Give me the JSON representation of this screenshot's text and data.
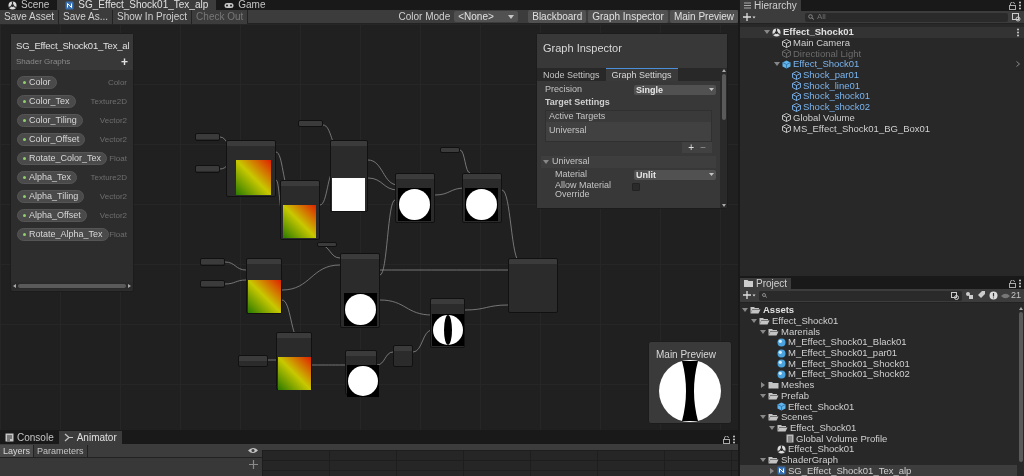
{
  "editor_tabs": [
    {
      "label": "Scene",
      "kind": "scene",
      "selected": false
    },
    {
      "label": "SG_Effect_Shock01_Tex_alp",
      "kind": "shader",
      "selected": true
    },
    {
      "label": "Game",
      "kind": "game",
      "selected": false
    }
  ],
  "toolbar": {
    "left_buttons": [
      {
        "label": "Save Asset",
        "disabled": false
      },
      {
        "label": "Save As...",
        "disabled": false
      },
      {
        "label": "Show In Project",
        "disabled": false
      },
      {
        "label": "Check Out",
        "disabled": true
      }
    ],
    "color_mode_label": "Color Mode",
    "color_mode_value": "<None>",
    "right_buttons": [
      "Blackboard",
      "Graph Inspector",
      "Main Preview"
    ]
  },
  "blackboard": {
    "title": "SG_Effect_Shock01_Tex_al",
    "subtitle": "Shader Graphs",
    "add": "+",
    "properties": [
      {
        "name": "Color",
        "type": "Color"
      },
      {
        "name": "Color_Tex",
        "type": "Texture2D"
      },
      {
        "name": "Color_Tiling",
        "type": "Vector2"
      },
      {
        "name": "Color_Offset",
        "type": "Vector2"
      },
      {
        "name": "Rotate_Color_Tex",
        "type": "Float"
      },
      {
        "name": "Alpha_Tex",
        "type": "Texture2D"
      },
      {
        "name": "Alpha_Tiling",
        "type": "Vector2"
      },
      {
        "name": "Alpha_Offset",
        "type": "Vector2"
      },
      {
        "name": "Rotate_Alpha_Tex",
        "type": "Float"
      }
    ]
  },
  "graph_inspector": {
    "title": "Graph Inspector",
    "tabs": [
      {
        "label": "Node Settings",
        "selected": false
      },
      {
        "label": "Graph Settings",
        "selected": true
      }
    ],
    "precision_label": "Precision",
    "precision_value": "Single",
    "target_settings": "Target Settings",
    "active_targets_header": "Active Targets",
    "active_targets": [
      "Universal"
    ],
    "add": "+",
    "remove": "−",
    "section": {
      "label": "Universal",
      "expanded": true
    },
    "material_label": "Material",
    "material_value": "Unlit",
    "override_label": "Allow Material Override",
    "override_checked": false
  },
  "main_preview": {
    "title": "Main Preview"
  },
  "bottom_tabs": [
    {
      "label": "Console",
      "kind": "console",
      "selected": false
    },
    {
      "label": "Animator",
      "kind": "animator",
      "selected": true
    }
  ],
  "animator_tabs": [
    {
      "label": "Layers",
      "selected": true
    },
    {
      "label": "Parameters",
      "selected": false
    }
  ],
  "hierarchy": {
    "title": "Hierarchy",
    "search_placeholder": "All",
    "tree": [
      {
        "label": "Effect_Shock01",
        "kind": "scene",
        "expanded": true,
        "children": [
          {
            "label": "Main Camera",
            "kind": "object",
            "disabled": false
          },
          {
            "label": "Directional Light",
            "kind": "object",
            "disabled": true
          },
          {
            "label": "Effect_Shock01",
            "kind": "prefab",
            "expanded": true,
            "disabled": false,
            "children": [
              {
                "label": "Shock_par01",
                "kind": "prefab_child",
                "disabled": false
              },
              {
                "label": "Shock_line01",
                "kind": "prefab_child",
                "disabled": false
              },
              {
                "label": "Shock_shock01",
                "kind": "prefab_child",
                "disabled": false
              },
              {
                "label": "Shock_shock02",
                "kind": "prefab_child",
                "disabled": false
              }
            ]
          },
          {
            "label": "Global Volume",
            "kind": "object",
            "disabled": false
          },
          {
            "label": "MS_Effect_Shock01_BG_Box01",
            "kind": "object",
            "disabled": false
          }
        ]
      }
    ]
  },
  "project": {
    "title": "Project",
    "hidden_count": "21",
    "tree": [
      {
        "label": "Assets",
        "kind": "folder",
        "expanded": true,
        "selected": false,
        "children": [
          {
            "label": "Effect_Shock01",
            "kind": "folder",
            "expanded": true,
            "selected": false,
            "children": [
              {
                "label": "Marerials",
                "kind": "folder",
                "expanded": true,
                "selected": false,
                "children": [
                  {
                    "label": "M_Effect_Shock01_Black01",
                    "kind": "material",
                    "selected": false
                  },
                  {
                    "label": "M_Effect_Shock01_par01",
                    "kind": "material",
                    "selected": false
                  },
                  {
                    "label": "M_Effect_Shock01_Shock01",
                    "kind": "material",
                    "selected": false
                  },
                  {
                    "label": "M_Effect_Shock01_Shock02",
                    "kind": "material",
                    "selected": false
                  }
                ]
              },
              {
                "label": "Meshes",
                "kind": "folder",
                "expanded": false,
                "selected": false
              },
              {
                "label": "Prefab",
                "kind": "folder",
                "expanded": true,
                "selected": false,
                "children": [
                  {
                    "label": "Effect_Shock01",
                    "kind": "prefab",
                    "selected": false
                  }
                ]
              },
              {
                "label": "Scenes",
                "kind": "folder",
                "expanded": true,
                "selected": false,
                "children": [
                  {
                    "label": "Effect_Shock01",
                    "kind": "folder",
                    "expanded": true,
                    "selected": false,
                    "children": [
                      {
                        "label": "Global Volume Profile",
                        "kind": "profile",
                        "selected": false
                      }
                    ]
                  },
                  {
                    "label": "Effect_Shock01",
                    "kind": "scene",
                    "selected": false
                  }
                ]
              },
              {
                "label": "ShaderGraph",
                "kind": "folder",
                "expanded": true,
                "selected": false,
                "children": [
                  {
                    "label": "SG_Effect_Shock01_Tex_alp",
                    "kind": "shader",
                    "expanded": false,
                    "selected": true
                  }
                ]
              }
            ]
          }
        ]
      }
    ]
  }
}
